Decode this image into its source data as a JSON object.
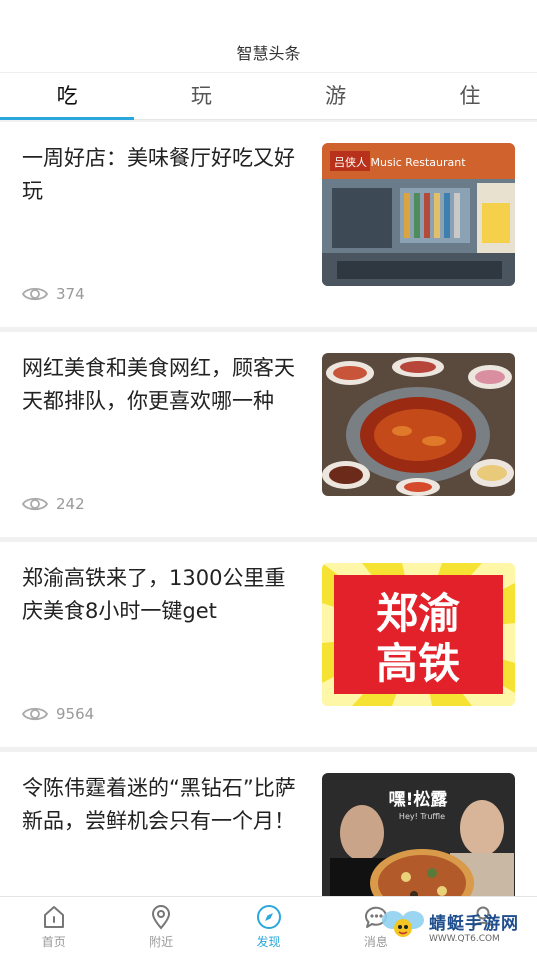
{
  "header": {
    "title": "智慧头条"
  },
  "tabs": [
    {
      "label": "吃",
      "active": true
    },
    {
      "label": "玩",
      "active": false
    },
    {
      "label": "游",
      "active": false
    },
    {
      "label": "住",
      "active": false
    }
  ],
  "feed": [
    {
      "headline": "一周好店：美味餐厅好吃又好玩",
      "views": "374",
      "thumb_sign": "吕侠人 Music Restaurant"
    },
    {
      "headline": "网红美食和美食网红，顾客天天都排队，你更喜欢哪一种",
      "views": "242"
    },
    {
      "headline": "郑渝高铁来了，1300公里重庆美食8小时一键get",
      "views": "9564",
      "thumb_line1": "郑渝",
      "thumb_line2": "高铁"
    },
    {
      "headline": "令陈伟霆着迷的“黑钻石”比萨新品，尝鲜机会只有一个月！",
      "views": "",
      "thumb_brand": "嘿!松露",
      "thumb_brand_sub": "Hey! Truffle"
    }
  ],
  "tabbar": [
    {
      "label": "首页",
      "icon": "home-icon",
      "active": false
    },
    {
      "label": "附近",
      "icon": "location-pin-icon",
      "active": false
    },
    {
      "label": "发现",
      "icon": "compass-icon",
      "active": true
    },
    {
      "label": "消息",
      "icon": "chat-bubble-icon",
      "active": false
    },
    {
      "label": "",
      "icon": "user-icon",
      "active": false
    }
  ],
  "watermark": {
    "text": "蜻蜓手游网",
    "url": "WWW.QT6.COM"
  },
  "colors": {
    "accent": "#2aa7dc",
    "muted": "#999999",
    "text": "#222222"
  }
}
